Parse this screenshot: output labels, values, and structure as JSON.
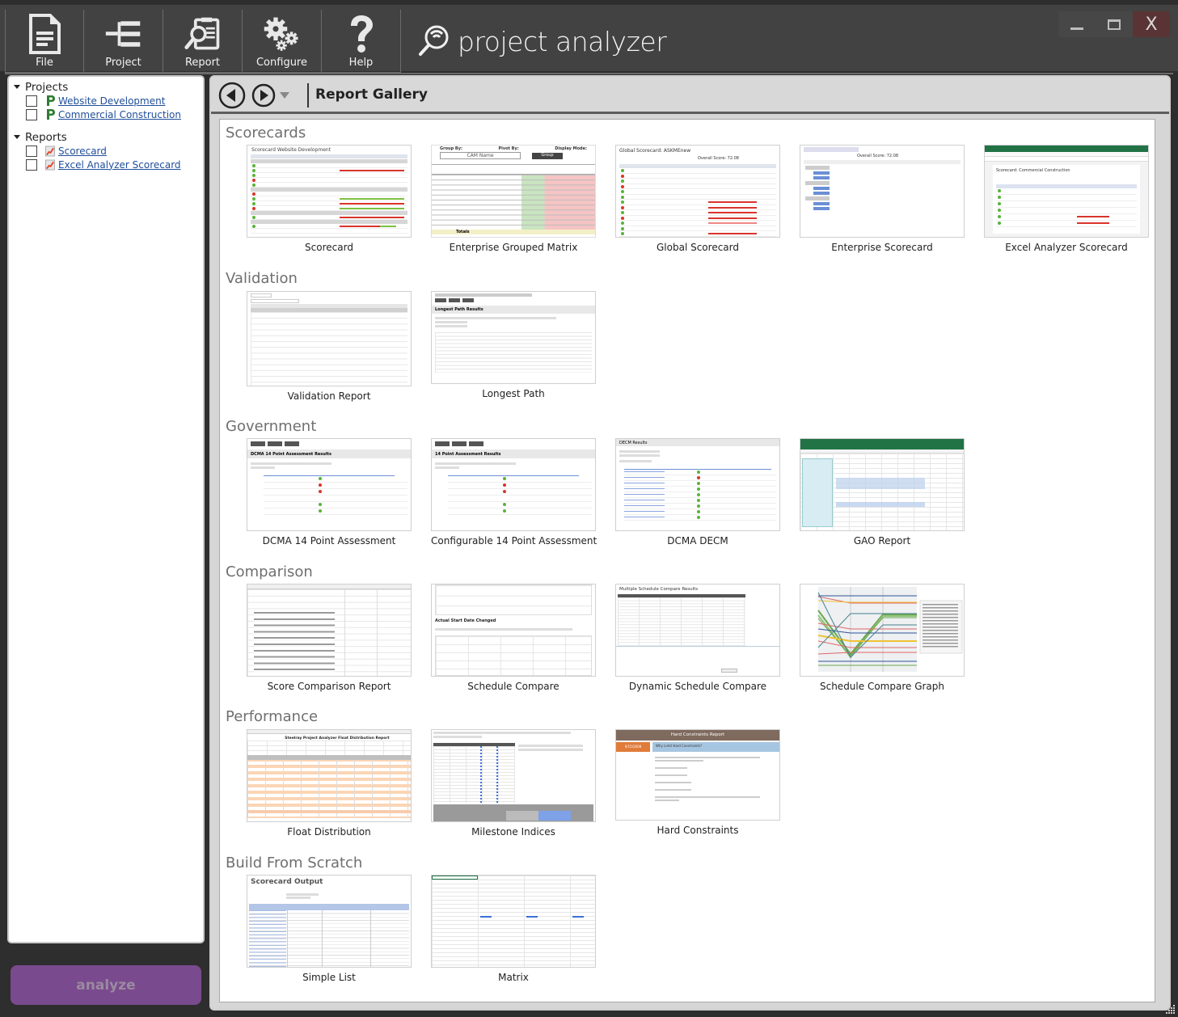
{
  "app": {
    "title": "project analyzer",
    "window_controls": {
      "minimize": "_",
      "maximize": "□",
      "close": "X"
    }
  },
  "ribbon": [
    {
      "label": "File",
      "icon": "file-icon"
    },
    {
      "label": "Project",
      "icon": "project-tree-icon"
    },
    {
      "label": "Report",
      "icon": "report-search-icon"
    },
    {
      "label": "Configure",
      "icon": "gears-icon"
    },
    {
      "label": "Help",
      "icon": "question-mark-icon"
    }
  ],
  "sidebar": {
    "projects_header": "Projects",
    "projects": [
      {
        "label": "Website Development",
        "checked": false
      },
      {
        "label": "Commercial Construction",
        "checked": false
      }
    ],
    "reports_header": "Reports",
    "reports": [
      {
        "label": "Scorecard",
        "checked": false
      },
      {
        "label": "Excel Analyzer Scorecard",
        "checked": false
      }
    ],
    "analyze_label": "analyze"
  },
  "main": {
    "title": "Report Gallery",
    "sections": [
      {
        "title": "Scorecards",
        "items": [
          "Scorecard",
          "Enterprise Grouped Matrix",
          "Global Scorecard",
          "Enterprise Scorecard",
          "Excel Analyzer Scorecard"
        ]
      },
      {
        "title": "Validation",
        "items": [
          "Validation Report",
          "Longest Path"
        ]
      },
      {
        "title": "Government",
        "items": [
          "DCMA 14 Point Assessment",
          "Configurable 14 Point Assessment",
          "DCMA DECM",
          "GAO Report"
        ]
      },
      {
        "title": "Comparison",
        "items": [
          "Score Comparison Report",
          "Schedule Compare",
          "Dynamic Schedule Compare",
          "Schedule Compare Graph"
        ]
      },
      {
        "title": "Performance",
        "items": [
          "Float Distribution",
          "Milestone Indices",
          "Hard Constraints"
        ]
      },
      {
        "title": "Build From Scratch",
        "items": [
          "Simple List",
          "Matrix"
        ]
      }
    ]
  },
  "thumbnails": {
    "scorecard_title": "Scorecard Website Development",
    "grouped_matrix": {
      "group_by": "Group By:",
      "cam_name": "CAM Name",
      "pivot_by": "Pivot By:",
      "group_btn": "Group",
      "display_mode": "Display Mode:",
      "totals": "Totals"
    },
    "global_scorecard_title": "Global Scorecard: ASKMEnew",
    "enterprise_scorecard_score": "Overall Score: 72.08",
    "excel_scorecard_title": "Scorecard: Commercial Construction",
    "longest_path_title": "Longest Path Results",
    "dcma_title": "DCMA 14 Point Assessment Results",
    "config14_title": "14 Point Assessment Results",
    "decm_title": "DECM Results",
    "msc_title": "Multiple Schedule Compare Results",
    "float_title": "Steelray Project Analyzer Float Distribution Report",
    "hard_constraints_title": "Hard Constraints Report",
    "hard_constraints_date": "9/15/2008",
    "hard_constraints_q": "Why Limit Hard Constraints?",
    "scorecard_output_title": "Scorecard Output",
    "schedule_compare_heading": "Actual Start Date Changed"
  },
  "colors": {
    "chrome_dark": "#424242",
    "analyze_button": "#7a4a8e",
    "link": "#1f4e9a",
    "section_title": "#6f6f6f",
    "excel_green": "#217346",
    "project_icon_green": "#2e7d32"
  }
}
